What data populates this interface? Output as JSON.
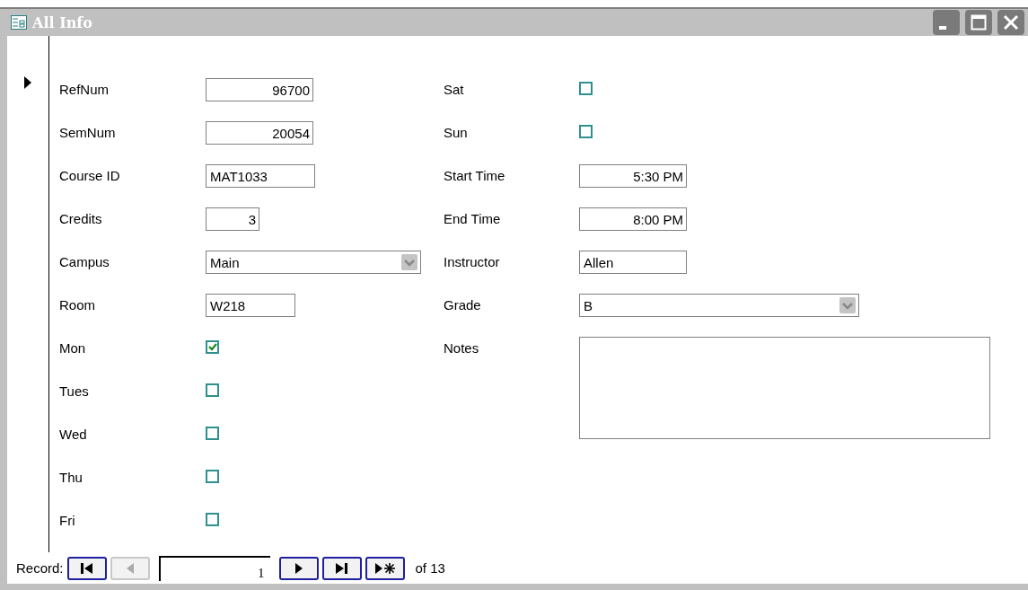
{
  "window": {
    "title": "All Info"
  },
  "record_selector": {
    "current": true
  },
  "left_fields": [
    {
      "label": "RefNum",
      "kind": "numeric",
      "value": "96700"
    },
    {
      "label": "SemNum",
      "kind": "numeric",
      "value": "20054"
    },
    {
      "label": "Course ID",
      "kind": "text",
      "value": "MAT1033"
    },
    {
      "label": "Credits",
      "kind": "numeric",
      "value": "3"
    },
    {
      "label": "Campus",
      "kind": "combo",
      "value": "Main"
    },
    {
      "label": "Room",
      "kind": "text",
      "value": "W218"
    },
    {
      "label": "Mon",
      "kind": "checkbox",
      "checked": true
    },
    {
      "label": "Tues",
      "kind": "checkbox",
      "checked": false
    },
    {
      "label": "Wed",
      "kind": "checkbox",
      "checked": false
    },
    {
      "label": "Thu",
      "kind": "checkbox",
      "checked": false
    },
    {
      "label": "Fri",
      "kind": "checkbox",
      "checked": false
    }
  ],
  "right_fields": [
    {
      "label": "Sat",
      "kind": "checkbox",
      "checked": false
    },
    {
      "label": "Sun",
      "kind": "checkbox",
      "checked": false
    },
    {
      "label": "Start Time",
      "kind": "numeric",
      "value": "5:30 PM"
    },
    {
      "label": "End Time",
      "kind": "numeric",
      "value": "8:00 PM"
    },
    {
      "label": "Instructor",
      "kind": "text",
      "value": "Allen"
    },
    {
      "label": "Grade",
      "kind": "combo",
      "value": "B"
    },
    {
      "label": "Notes",
      "kind": "memo"
    }
  ],
  "navigation": {
    "label": "Record:",
    "buttons": [
      {
        "kind": "first",
        "disabled": false
      },
      {
        "kind": "prev",
        "disabled": true
      }
    ],
    "current": "1",
    "buttons_after": [
      {
        "kind": "next",
        "disabled": false
      },
      {
        "kind": "last",
        "disabled": false
      },
      {
        "kind": "new",
        "disabled": false
      }
    ],
    "total": "of 13"
  }
}
